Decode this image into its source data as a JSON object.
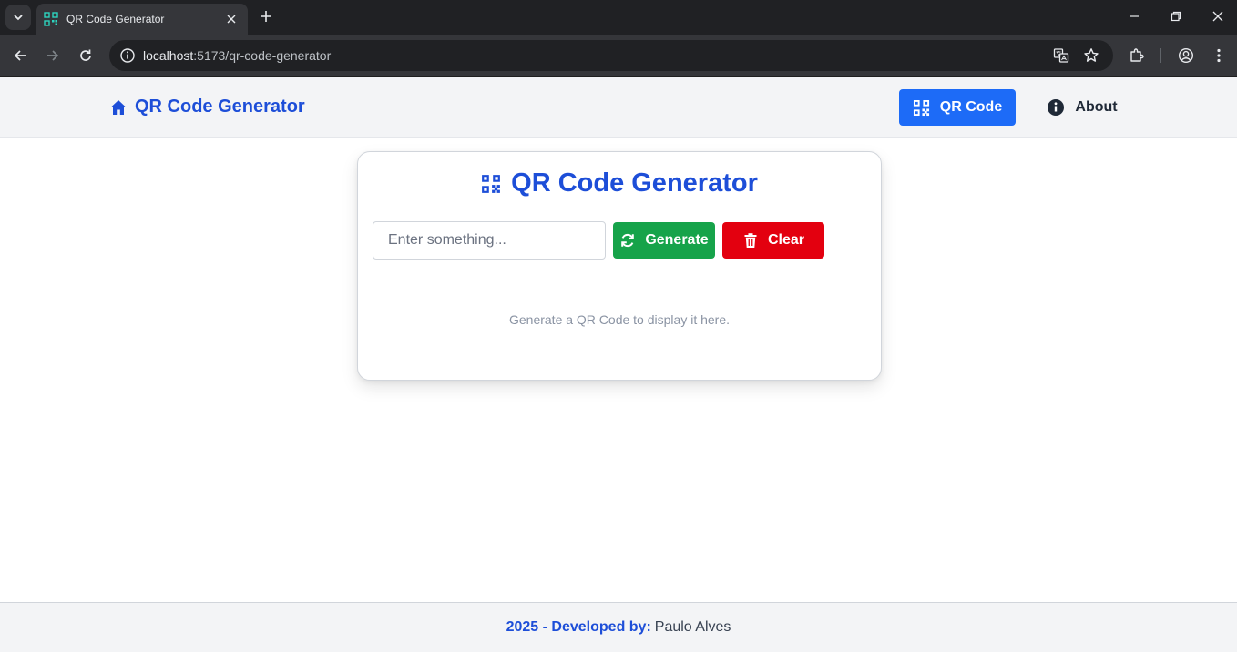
{
  "browser": {
    "tab_title": "QR Code Generator",
    "url_host": "localhost",
    "url_rest": ":5173/qr-code-generator"
  },
  "header": {
    "brand": "QR Code Generator",
    "nav": {
      "qr_code": "QR Code",
      "about": "About"
    }
  },
  "card": {
    "title": "QR Code Generator",
    "input_placeholder": "Enter something...",
    "input_value": "",
    "generate_label": "Generate",
    "clear_label": "Clear",
    "empty_message": "Generate a QR Code to display it here."
  },
  "footer": {
    "prefix": "2025 - Developed by:",
    "author": "Paulo Alves"
  },
  "colors": {
    "brand_blue": "#1d4ed8",
    "nav_active": "#1d6bf7",
    "generate": "#16a34a",
    "clear": "#e3000f"
  }
}
